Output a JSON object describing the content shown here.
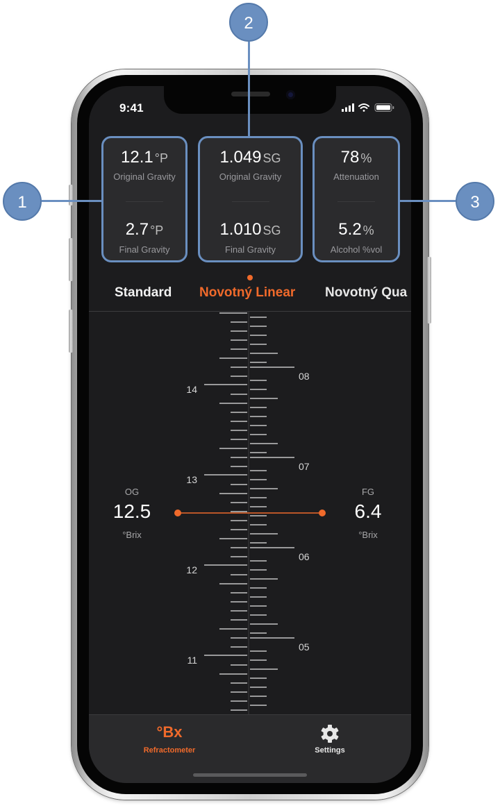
{
  "status_bar": {
    "time": "9:41"
  },
  "cards": [
    {
      "top_value": "12.1",
      "top_unit": "°P",
      "top_label": "Original Gravity",
      "bottom_value": "2.7",
      "bottom_unit": "°P",
      "bottom_label": "Final Gravity"
    },
    {
      "top_value": "1.049",
      "top_unit": "SG",
      "top_label": "Original Gravity",
      "bottom_value": "1.010",
      "bottom_unit": "SG",
      "bottom_label": "Final Gravity"
    },
    {
      "top_value": "78",
      "top_unit": "%",
      "top_label": "Attenuation",
      "bottom_value": "5.2",
      "bottom_unit": "%",
      "bottom_label": "Alcohol %vol"
    }
  ],
  "methods": {
    "tabs": [
      "Standard",
      "Novotný Linear",
      "Novotný Qua"
    ],
    "active": "Novotný Linear"
  },
  "scale": {
    "left_labels": [
      "14",
      "13",
      "12",
      "11"
    ],
    "right_labels": [
      "08",
      "07",
      "06",
      "05"
    ],
    "og": {
      "label": "OG",
      "value": "12.5",
      "unit": "°Brix"
    },
    "fg": {
      "label": "FG",
      "value": "6.4",
      "unit": "°Brix"
    }
  },
  "tabbar": {
    "items": [
      {
        "icon_text": "°Bx",
        "label": "Refractometer",
        "active": true
      },
      {
        "icon": "gear-icon",
        "label": "Settings",
        "active": false
      }
    ]
  },
  "callouts": [
    "1",
    "2",
    "3"
  ],
  "colors": {
    "accent": "#f06a2b",
    "callout": "#6a8fc0",
    "background": "#1c1c1e",
    "card": "#2b2b2d"
  }
}
